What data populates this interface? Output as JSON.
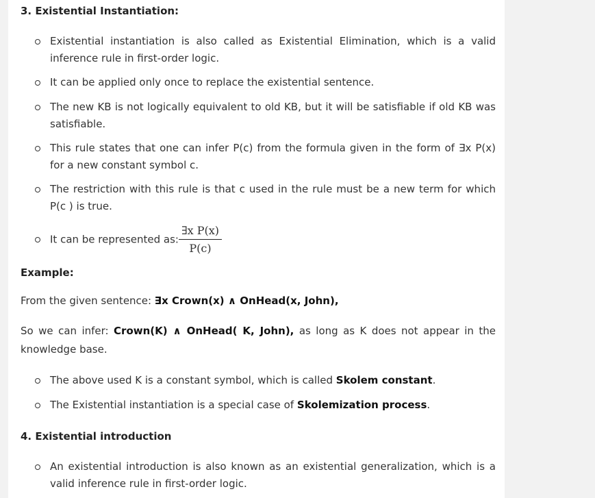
{
  "section3": {
    "heading": "3. Existential Instantiation:",
    "bullets": [
      "Existential instantiation is also called as Existential Elimination, which is a valid inference rule in first-order logic.",
      "It can be applied only once to replace the existential sentence.",
      "The new KB is not logically equivalent to old KB, but it will be satisfiable if old KB was satisfiable.",
      "This rule states that one can infer P(c) from the formula given in the form of ∃x P(x) for a new constant symbol c.",
      "The restriction with this rule is that c used in the rule must be a new term for which P(c ) is true."
    ],
    "represented_label": "It can be represented as:",
    "fraction_numerator": "∃x P(x)",
    "fraction_denominator": "P(c)"
  },
  "example": {
    "heading": "Example:",
    "line1_prefix": "From the given sentence: ",
    "line1_bold": "∃x Crown(x) ∧ OnHead(x, John),",
    "line2_prefix": "So we can infer: ",
    "line2_bold": "Crown(K) ∧ OnHead( K, John),",
    "line2_suffix": " as long as K does not appear in the knowledge base.",
    "bullet1_prefix": "The above used K is a constant symbol, which is called ",
    "bullet1_bold": "Skolem constant",
    "bullet1_suffix": ".",
    "bullet2_prefix": "The Existential instantiation is a special case of ",
    "bullet2_bold": "Skolemization process",
    "bullet2_suffix": "."
  },
  "section4": {
    "heading": "4. Existential introduction",
    "bullets": [
      "An existential introduction is also known as an existential generalization, which is a valid inference rule in first-order logic."
    ]
  }
}
